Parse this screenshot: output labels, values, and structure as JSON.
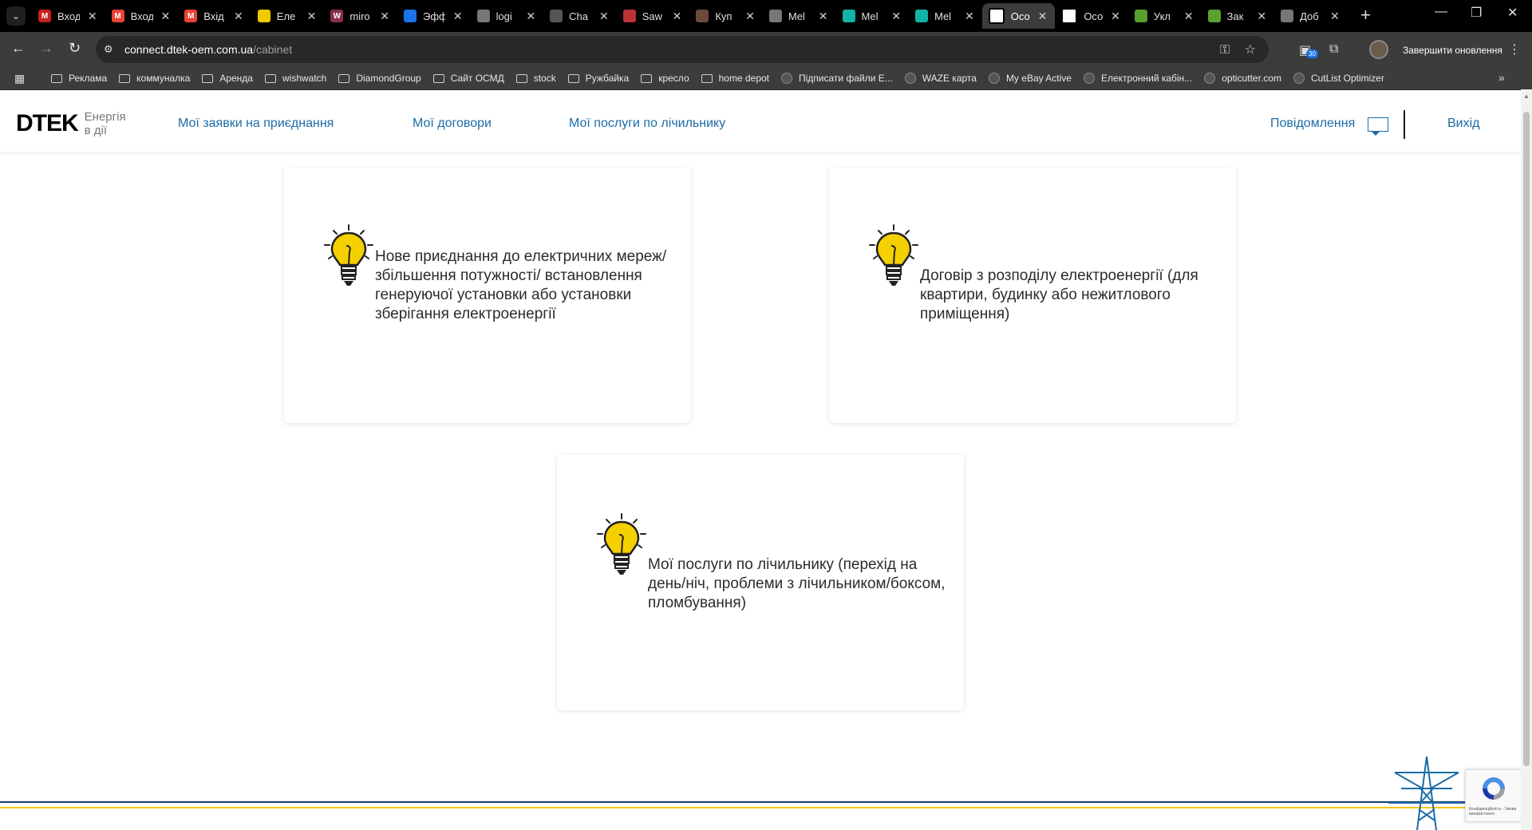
{
  "browser": {
    "tabs": [
      {
        "title": "Вход",
        "fav_text": "M",
        "fav_color": "#c5221f"
      },
      {
        "title": "Вход",
        "fav_text": "M",
        "fav_color": "#ea4335"
      },
      {
        "title": "Вхід",
        "fav_text": "M",
        "fav_color": "#ea4335"
      },
      {
        "title": "Еле",
        "fav_text": "",
        "fav_color": "#f2c800"
      },
      {
        "title": "miro",
        "fav_text": "W",
        "fav_color": "#8a2b4e"
      },
      {
        "title": "Эфф",
        "fav_text": "",
        "fav_color": "#1a73e8"
      },
      {
        "title": "logi",
        "fav_text": "",
        "fav_color": "#777777"
      },
      {
        "title": "Cha",
        "fav_text": "",
        "fav_color": "#555555"
      },
      {
        "title": "Saw",
        "fav_text": "",
        "fav_color": "#b33"
      },
      {
        "title": "Куп",
        "fav_text": "",
        "fav_color": "#6b4a3a"
      },
      {
        "title": "Mel",
        "fav_text": "",
        "fav_color": "#777777"
      },
      {
        "title": "Mel",
        "fav_text": "",
        "fav_color": "#12b5a5"
      },
      {
        "title": "Mel",
        "fav_text": "",
        "fav_color": "#12b5a5"
      },
      {
        "title": "Осо",
        "fav_text": "",
        "fav_color": "#ffffff",
        "active": true
      },
      {
        "title": "Осо",
        "fav_text": "",
        "fav_color": "#ffffff"
      },
      {
        "title": "Укл",
        "fav_text": "",
        "fav_color": "#5aa02c"
      },
      {
        "title": "Зак",
        "fav_text": "",
        "fav_color": "#5aa02c"
      },
      {
        "title": "Доб",
        "fav_text": "",
        "fav_color": "#777777"
      }
    ],
    "url_domain": "connect.dtek-oem.com.ua",
    "url_path": "/cabinet",
    "update_label": "Завершити оновлення",
    "ext_badge": "30",
    "bookmarks": [
      {
        "label": "Реклама",
        "type": "folder"
      },
      {
        "label": "коммуналка",
        "type": "folder"
      },
      {
        "label": "Аренда",
        "type": "folder"
      },
      {
        "label": "wishwatch",
        "type": "folder"
      },
      {
        "label": "DiamondGroup",
        "type": "folder"
      },
      {
        "label": "Сайт ОСМД",
        "type": "folder"
      },
      {
        "label": "stock",
        "type": "folder"
      },
      {
        "label": "Ружбайка",
        "type": "folder"
      },
      {
        "label": "кресло",
        "type": "folder"
      },
      {
        "label": "home depot",
        "type": "folder"
      },
      {
        "label": "Підписати файли Е...",
        "type": "site"
      },
      {
        "label": "WAZE карта",
        "type": "site"
      },
      {
        "label": "My eBay Active",
        "type": "site"
      },
      {
        "label": "Електронний кабін...",
        "type": "site"
      },
      {
        "label": "opticutter.com",
        "type": "site"
      },
      {
        "label": "CutList Optimizer",
        "type": "site"
      }
    ]
  },
  "header": {
    "logo": "DTEK",
    "tagline_1": "Енергія",
    "tagline_2": "в дії",
    "nav": [
      "Мої заявки на приєднання",
      "Мої договори",
      "Мої послуги по лічильнику"
    ],
    "notifications": "Повідомлення",
    "logout": "Вихід"
  },
  "cards": [
    {
      "text": "Нове приєднання до електричних мереж/збільшення потужності/ встановлення генеруючої установки або установки зберігання електроенергії"
    },
    {
      "text": "Договір з розподілу електроенергії (для квартири, будинку або нежитлового приміщення)"
    },
    {
      "text": "Мої послуги по лічильнику (перехід на день/ніч, проблеми з лічильником/боксом, пломбування)"
    }
  ],
  "recaptcha": {
    "text": "Конфіденційність - Умови використання"
  },
  "colors": {
    "accent": "#1b6ca8",
    "bulb": "#f5d000",
    "footer_blue": "#1b3c6b",
    "footer_yellow": "#f2c800"
  }
}
